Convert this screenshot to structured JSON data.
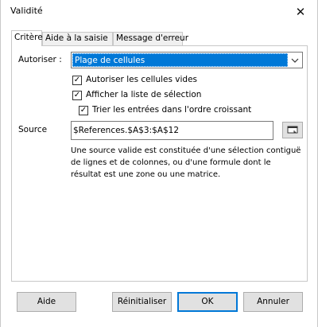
{
  "window": {
    "title": "Validité",
    "close_glyph": "✕"
  },
  "tabs": [
    {
      "label": "Critère",
      "active": true
    },
    {
      "label": "Aide à la saisie",
      "active": false
    },
    {
      "label": "Message d'erreur",
      "active": false
    }
  ],
  "criteria": {
    "allow_label": "Autoriser :",
    "allow_value": "Plage de cellules",
    "allow_blank_label": "Autoriser les cellules vides",
    "allow_blank_checked": true,
    "show_list_label": "Afficher la liste de sélection",
    "show_list_checked": true,
    "sort_label": "Trier les entrées dans l'ordre croissant",
    "sort_checked": true,
    "source_label": "Source",
    "source_value": "$References.$A$3:$A$12",
    "help_text": "Une source valide est constituée d'une sélection contiguë de lignes et de colonnes, ou d'une formule dont le résultat est une zone ou une matrice."
  },
  "buttons": {
    "help": "Aide",
    "reset": "Réinitialiser",
    "ok": "OK",
    "cancel": "Annuler"
  },
  "colors": {
    "accent": "#0078d7",
    "button_bg": "#e1e1e1",
    "border": "#c8c8c8"
  }
}
